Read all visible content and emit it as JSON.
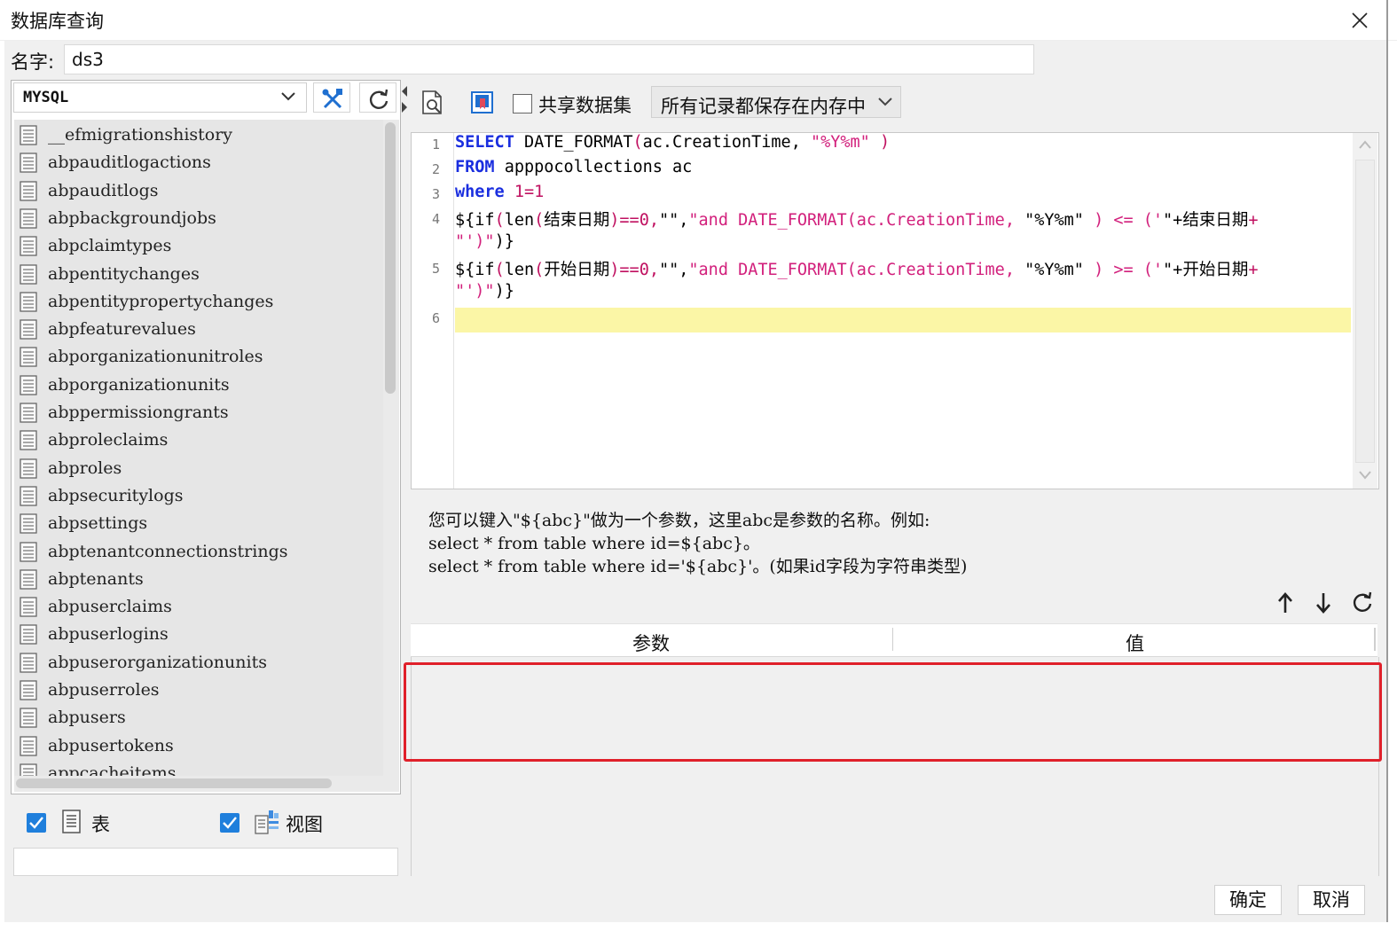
{
  "window": {
    "title": "数据库查询",
    "close_symbol": "✕"
  },
  "name": {
    "label": "名字:",
    "value": "ds3"
  },
  "connection": {
    "selected": "MYSQL"
  },
  "tables": [
    "__efmigrationshistory",
    "abpauditlogactions",
    "abpauditlogs",
    "abpbackgroundjobs",
    "abpclaimtypes",
    "abpentitychanges",
    "abpentitypropertychanges",
    "abpfeaturevalues",
    "abporganizationunitroles",
    "abporganizationunits",
    "abppermissiongrants",
    "abproleclaims",
    "abproles",
    "abpsecuritylogs",
    "abpsettings",
    "abptenantconnectionstrings",
    "abptenants",
    "abpuserclaims",
    "abpuserlogins",
    "abpuserorganizationunits",
    "abpuserroles",
    "abpusers",
    "abpusertokens",
    "appcacheitems"
  ],
  "filters": {
    "table_label": "表",
    "view_label": "视图",
    "table_checked": true,
    "view_checked": true
  },
  "toolbar": {
    "share_label": "共享数据集",
    "share_checked": false,
    "memory_option": "所有记录都保存在内存中"
  },
  "editor": {
    "line_numbers": [
      "1",
      "2",
      "3",
      "4",
      "5",
      "6"
    ],
    "lines": [
      [
        {
          "t": "SELECT",
          "c": "kw"
        },
        {
          "t": " DATE_FORMAT",
          "c": ""
        },
        {
          "t": "(",
          "c": "op"
        },
        {
          "t": "ac.CreationTime, ",
          "c": ""
        },
        {
          "t": "\"%Y%m\"",
          "c": "str"
        },
        {
          "t": " )",
          "c": "op"
        }
      ],
      [
        {
          "t": "FROM",
          "c": "kw"
        },
        {
          "t": " apppocollections ac",
          "c": ""
        }
      ],
      [
        {
          "t": "where",
          "c": "kw"
        },
        {
          "t": " 1=1",
          "c": "op"
        }
      ],
      [
        {
          "t": "${if",
          "c": ""
        },
        {
          "t": "(",
          "c": "op"
        },
        {
          "t": "len",
          "c": ""
        },
        {
          "t": "(",
          "c": "op"
        },
        {
          "t": "结束日期",
          "c": ""
        },
        {
          "t": ")==0,",
          "c": "op"
        },
        {
          "t": "\"\",",
          "c": ""
        },
        {
          "t": "\"and DATE_FORMAT(ac.CreationTime, ",
          "c": "str"
        },
        {
          "t": "\"%Y%m\"",
          "c": ""
        },
        {
          "t": " ) <= ('",
          "c": "str"
        },
        {
          "t": "\"+",
          "c": ""
        },
        {
          "t": "结束日期",
          "c": ""
        },
        {
          "t": "+",
          "c": "op"
        }
      ],
      [
        {
          "t": "\"')\"",
          "c": "str"
        },
        {
          "t": ")}",
          "c": ""
        }
      ],
      [
        {
          "t": "${if",
          "c": ""
        },
        {
          "t": "(",
          "c": "op"
        },
        {
          "t": "len",
          "c": ""
        },
        {
          "t": "(",
          "c": "op"
        },
        {
          "t": "开始日期",
          "c": ""
        },
        {
          "t": ")==0,",
          "c": "op"
        },
        {
          "t": "\"\",",
          "c": ""
        },
        {
          "t": "\"and DATE_FORMAT(ac.CreationTime, ",
          "c": "str"
        },
        {
          "t": "\"%Y%m\"",
          "c": ""
        },
        {
          "t": " ) >= ('",
          "c": "str"
        },
        {
          "t": "\"+",
          "c": ""
        },
        {
          "t": "开始日期",
          "c": ""
        },
        {
          "t": "+",
          "c": "op"
        }
      ],
      [
        {
          "t": "\"')\"",
          "c": "str"
        },
        {
          "t": ")}",
          "c": ""
        }
      ]
    ]
  },
  "hints": {
    "line1": "您可以键入\"${abc}\"做为一个参数，这里abc是参数的名称。例如:",
    "line2": "select * from table where id=${abc}。",
    "line3": "select * from table where id='${abc}'。(如果id字段为字符串类型)"
  },
  "params": {
    "col_param": "参数",
    "col_value": "值",
    "rows": []
  },
  "buttons": {
    "ok": "确定",
    "cancel": "取消"
  },
  "colors": {
    "highlight_border": "#e0202a",
    "current_line": "#fbf6a6",
    "keyword": "#1a2edf",
    "string": "#d2207c"
  }
}
